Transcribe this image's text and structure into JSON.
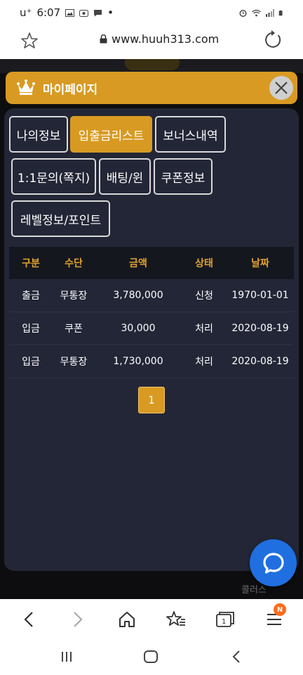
{
  "status_bar": {
    "carrier": "u⁺",
    "time": "6:07",
    "dot": "•"
  },
  "browser": {
    "url": "www.huuh313.com"
  },
  "header": {
    "title": "마이페이지"
  },
  "tabs": [
    {
      "label": "나의정보",
      "active": false
    },
    {
      "label": "입출금리스트",
      "active": true
    },
    {
      "label": "보너스내역",
      "active": false
    },
    {
      "label": "1:1문의(쪽지)",
      "active": false
    },
    {
      "label": "배팅/윈",
      "active": false
    },
    {
      "label": "쿠폰정보",
      "active": false
    },
    {
      "label": "레벨정보/포인트",
      "active": false
    }
  ],
  "table": {
    "headers": [
      "구분",
      "수단",
      "금액",
      "상태",
      "날짜"
    ],
    "rows": [
      [
        "출금",
        "무통장",
        "3,780,000",
        "신청",
        "1970-01-01"
      ],
      [
        "입금",
        "쿠폰",
        "30,000",
        "처리",
        "2020-08-19"
      ],
      [
        "입금",
        "무통장",
        "1,730,000",
        "처리",
        "2020-08-19"
      ]
    ]
  },
  "pagination": {
    "current_page": "1"
  },
  "background_label": "콜러스",
  "nav_badge": "N",
  "colors": {
    "accent": "#d89a22",
    "panel": "#232636",
    "header_text": "#e0a22b",
    "chat": "#1f6fe0"
  }
}
